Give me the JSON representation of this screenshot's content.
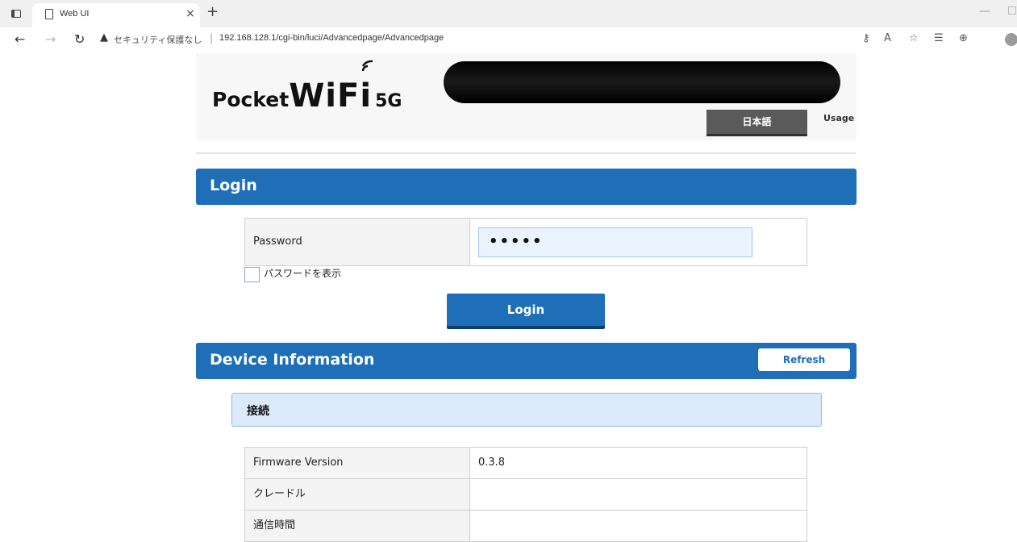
{
  "browser": {
    "tab_title": "Web UI",
    "tab_close": "×",
    "new_tab": "+",
    "security_label": "セキュリティ保護なし",
    "url_separator": "|",
    "url": "192.168.128.1/cgi-bin/luci/Advancedpage/Advancedpage"
  },
  "header": {
    "logo": {
      "pocket": "Pocket",
      "wifi": "WiFi",
      "fiveg": "5G"
    },
    "language_button": "日本語",
    "usage_link": "Usage"
  },
  "login": {
    "section_title": "Login",
    "password_label": "Password",
    "password_value": "•••••",
    "show_password_label": "パスワードを表示",
    "login_button": "Login"
  },
  "device_info": {
    "section_title": "Device Information",
    "refresh_button": "Refresh",
    "subsection_title": "接続",
    "rows": [
      {
        "key": "Firmware Version",
        "value": "0.3.8"
      },
      {
        "key": "クレードル",
        "value": ""
      },
      {
        "key": "通信時間",
        "value": ""
      }
    ]
  },
  "colors": {
    "accent_blue": "#1e6eb8",
    "subsection_bg": "#dcebfb",
    "input_bg": "#eaf4fe"
  }
}
